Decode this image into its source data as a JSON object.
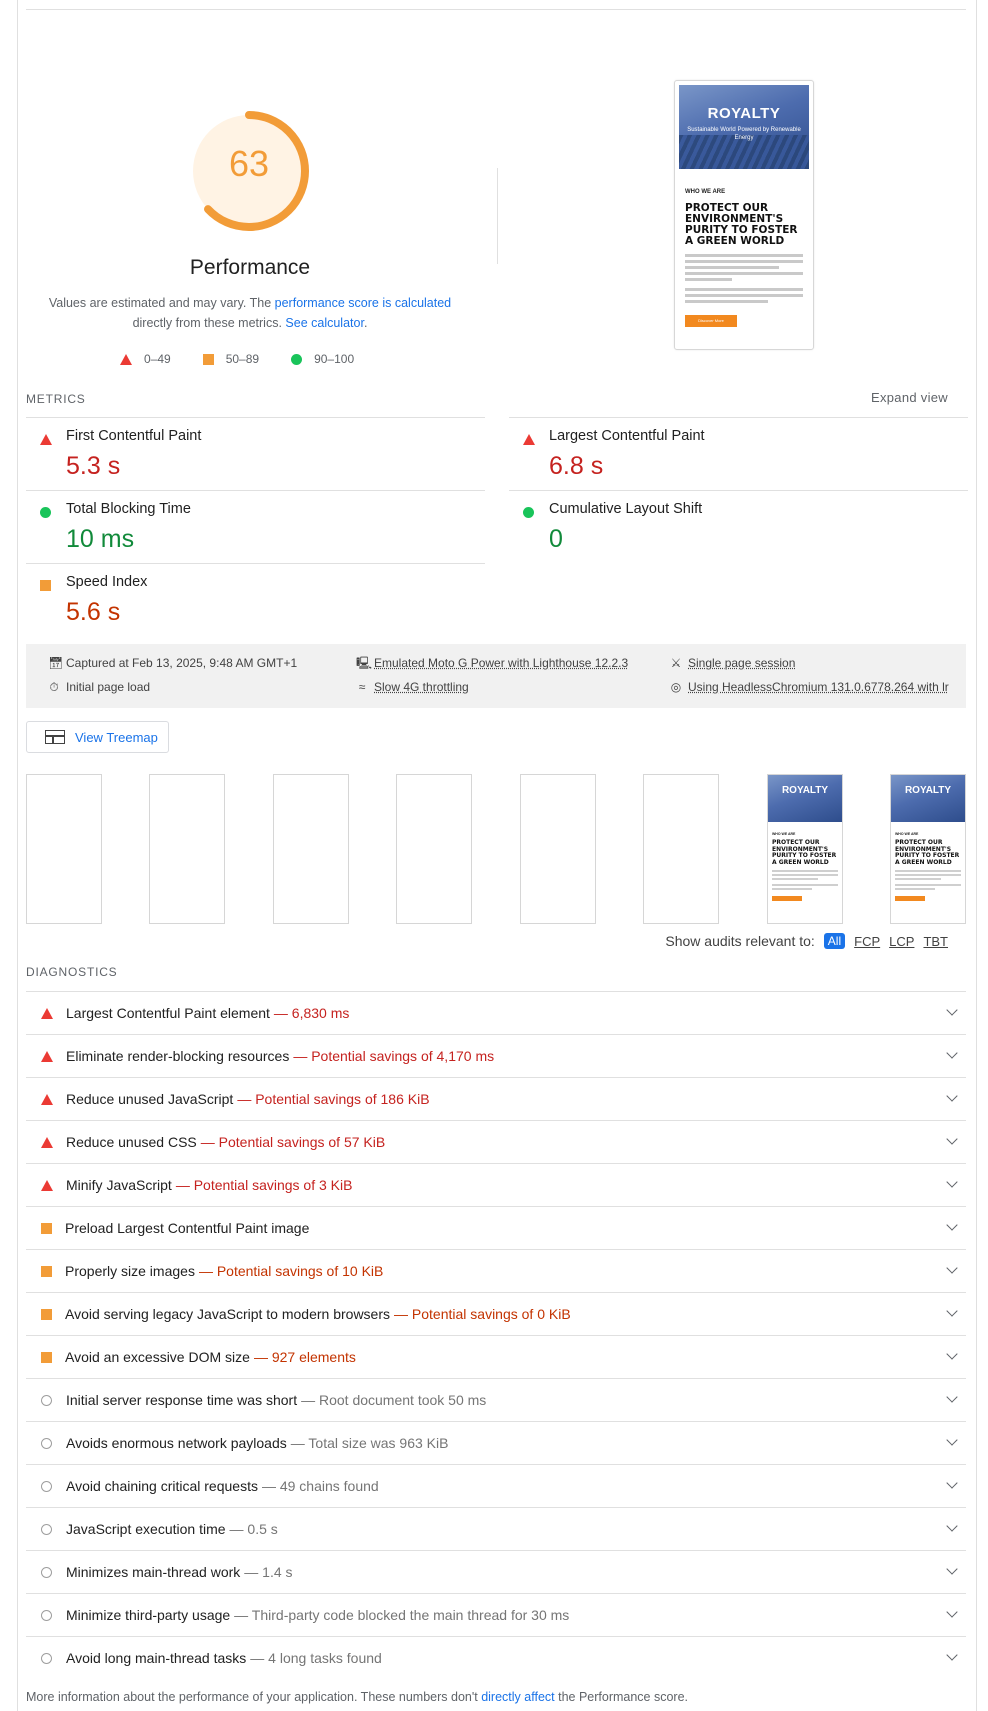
{
  "gauge": {
    "score": "63",
    "score_fraction": 0.63,
    "title": "Performance"
  },
  "description": {
    "prefix": "Values are estimated and may vary. The ",
    "link1": "performance score is calculated",
    "middle": " directly from these metrics. ",
    "link2": "See calculator",
    "suffix": "."
  },
  "legend": [
    {
      "icon": "triangle-red",
      "label": "0–49"
    },
    {
      "icon": "square-orange",
      "label": "50–89"
    },
    {
      "icon": "circle-green",
      "label": "90–100"
    }
  ],
  "preview": {
    "brand": "ROYALTY",
    "tagline": "Sustainable World Powered by Renewable Energy",
    "eyebrow": "WHO WE ARE",
    "headline": "PROTECT OUR ENVIRONMENT'S PURITY TO FOSTER A GREEN WORLD",
    "button": "Discover More"
  },
  "metrics": {
    "label": "METRICS",
    "expand": "Expand view",
    "items": [
      {
        "name": "First Contentful Paint",
        "value": "5.3 s",
        "status": "fail"
      },
      {
        "name": "Largest Contentful Paint",
        "value": "6.8 s",
        "status": "fail"
      },
      {
        "name": "Total Blocking Time",
        "value": "10 ms",
        "status": "pass"
      },
      {
        "name": "Cumulative Layout Shift",
        "value": "0",
        "status": "pass"
      },
      {
        "name": "Speed Index",
        "value": "5.6 s",
        "status": "average"
      }
    ]
  },
  "runtime": {
    "captured": "Captured at Feb 13, 2025, 9:48 AM GMT+1",
    "device": "Emulated Moto G Power with Lighthouse 12.2.3",
    "session": "Single page session",
    "load": "Initial page load",
    "throttle": "Slow 4G throttling",
    "browser": "Using HeadlessChromium 131.0.6778.264 with lr"
  },
  "treemap": {
    "label": "View Treemap"
  },
  "filmstrip": {
    "frames": 8,
    "loaded_from_index": 6,
    "brand": "ROYALTY",
    "eyebrow": "WHO WE ARE",
    "headline": "PROTECT OUR ENVIRONMENT'S PURITY TO FOSTER A GREEN WORLD"
  },
  "filter": {
    "label": "Show audits relevant to:",
    "options": [
      "All",
      "FCP",
      "LCP",
      "TBT"
    ],
    "selected": "All"
  },
  "diagnostics": {
    "label": "DIAGNOSTICS",
    "items": [
      {
        "title": "Largest Contentful Paint element",
        "display": "— 6,830 ms",
        "status": "fail"
      },
      {
        "title": "Eliminate render-blocking resources",
        "display": "— Potential savings of 4,170 ms",
        "status": "fail"
      },
      {
        "title": "Reduce unused JavaScript",
        "display": "— Potential savings of 186 KiB",
        "status": "fail"
      },
      {
        "title": "Reduce unused CSS",
        "display": "— Potential savings of 57 KiB",
        "status": "fail"
      },
      {
        "title": "Minify JavaScript",
        "display": "— Potential savings of 3 KiB",
        "status": "fail"
      },
      {
        "title": "Preload Largest Contentful Paint image",
        "display": "",
        "status": "average"
      },
      {
        "title": "Properly size images",
        "display": "— Potential savings of 10 KiB",
        "status": "average"
      },
      {
        "title": "Avoid serving legacy JavaScript to modern browsers",
        "display": "— Potential savings of 0 KiB",
        "status": "average"
      },
      {
        "title": "Avoid an excessive DOM size",
        "display": "— 927 elements",
        "status": "average"
      },
      {
        "title": "Initial server response time was short",
        "display": "— Root document took 50 ms",
        "status": "info"
      },
      {
        "title": "Avoids enormous network payloads",
        "display": "— Total size was 963 KiB",
        "status": "info"
      },
      {
        "title": "Avoid chaining critical requests",
        "display": "— 49 chains found",
        "status": "info"
      },
      {
        "title": "JavaScript execution time",
        "display": "— 0.5 s",
        "status": "info"
      },
      {
        "title": "Minimizes main-thread work",
        "display": "— 1.4 s",
        "status": "info"
      },
      {
        "title": "Minimize third-party usage",
        "display": "— Third-party code blocked the main thread for 30 ms",
        "status": "info"
      },
      {
        "title": "Avoid long main-thread tasks",
        "display": "— 4 long tasks found",
        "status": "info"
      }
    ]
  },
  "footer": {
    "prefix": "More information about the performance of your application. These numbers don't ",
    "link": "directly affect",
    "suffix": " the Performance score."
  },
  "colors": {
    "fail": "#eb3a34",
    "average": "#f29c38",
    "pass": "#19c45a",
    "link": "#1a73e8"
  }
}
